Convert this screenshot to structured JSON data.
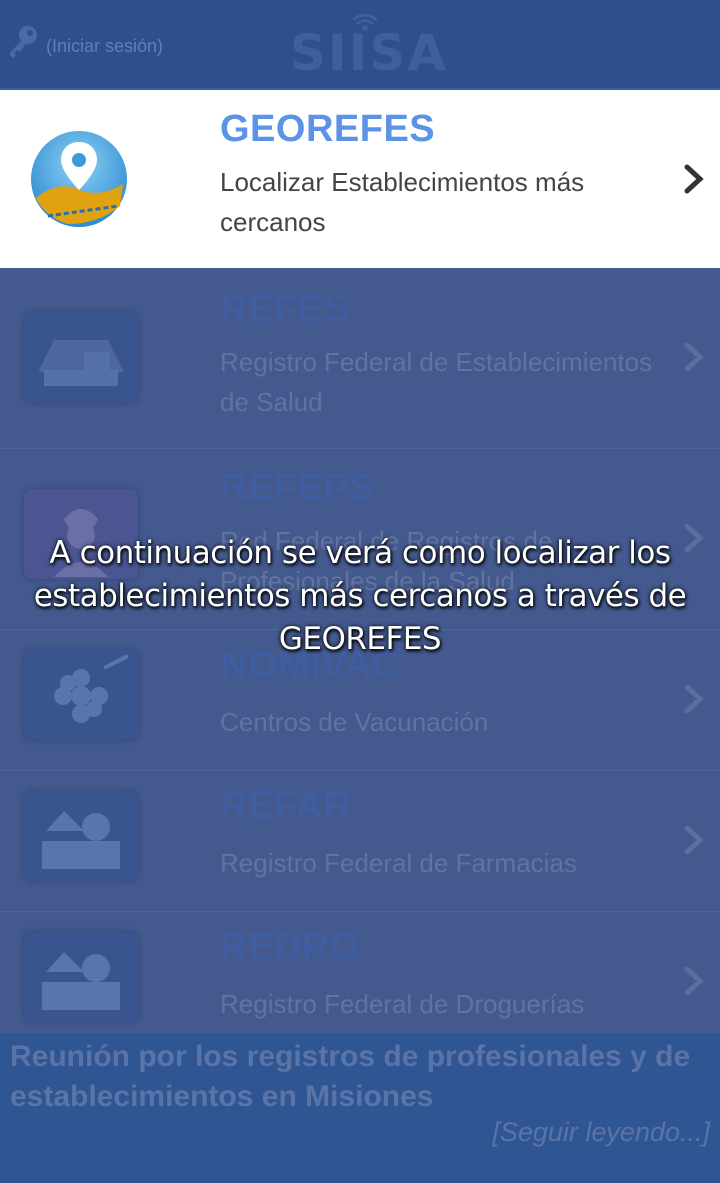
{
  "header": {
    "login_label": "(Iniciar sesión)",
    "logo_text": "SIISA",
    "key_icon": "key-icon"
  },
  "items": [
    {
      "name": "GEOREFES",
      "desc": "Localizar Establecimientos más cercanos",
      "icon": "map-pin-icon",
      "highlighted": true
    },
    {
      "name": "REFES",
      "desc": "Registro Federal de Establecimientos de Salud",
      "icon": "hospital-building-icon"
    },
    {
      "name": "REFEPS",
      "desc": "Red Federal de Registros de Profesionales de la Salud",
      "icon": "doctor-icon"
    },
    {
      "name": "NOMIVAC",
      "desc": "Centros de Vacunación",
      "icon": "vaccine-icon"
    },
    {
      "name": "REFAR",
      "desc": "Registro Federal de Farmacias",
      "icon": "pharmacy-icon"
    },
    {
      "name": "REDRO",
      "desc": "Registro Federal de Droguerías",
      "icon": "drugstore-icon"
    }
  ],
  "overlay": {
    "caption": "A continuación se verá como localizar los establecimientos más cercanos a través de GEOREFES"
  },
  "news": {
    "title": "Reunión por los registros de profesionales y de establecimientos en Misiones",
    "more": "[Seguir leyendo...]"
  },
  "colors": {
    "header_bg": "#2e4f8c",
    "dim_bg": "#44598e",
    "accent_blue": "#5b93e6",
    "highlight_bg": "#ffffff"
  }
}
